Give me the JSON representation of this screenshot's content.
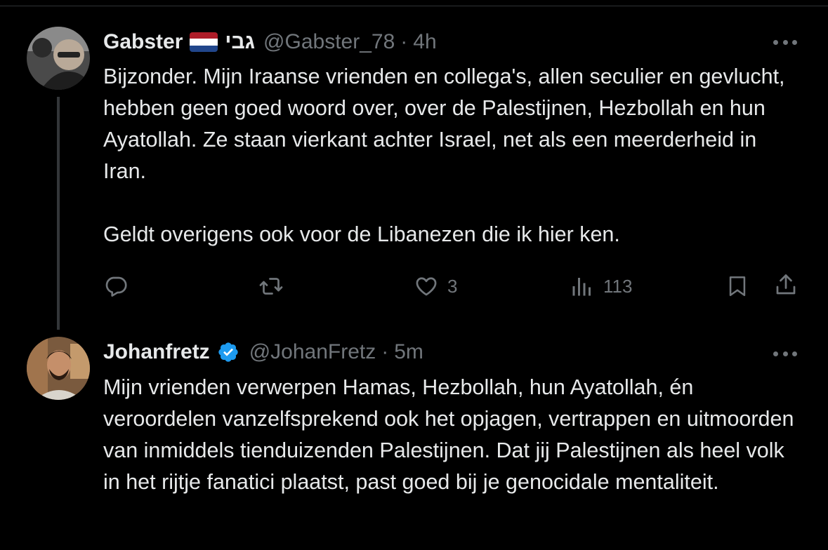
{
  "tweets": [
    {
      "name": "Gabster",
      "hebrew": "גבי",
      "handle": "@Gabster_78",
      "time": "4h",
      "paragraphs": [
        "Bijzonder. Mijn Iraanse vrienden en collega's, allen seculier en gevlucht, hebben geen goed woord over, over de Palestijnen, Hezbollah en hun Ayatollah. Ze staan vierkant achter Israel, net als een meerderheid in Iran.",
        "Geldt overigens ook voor de Libanezen die ik hier ken."
      ],
      "likes": "3",
      "views": "113"
    },
    {
      "name": "Johanfretz",
      "handle": "@JohanFretz",
      "time": "5m",
      "paragraphs": [
        "Mijn vrienden verwerpen Hamas, Hezbollah, hun Ayatollah, én veroordelen vanzelfsprekend ook het opjagen, vertrappen en uitmoorden van inmiddels tienduizenden Palestijnen. Dat jij Palestijnen als heel volk in het rijtje fanatici plaatst, past goed bij je genocidale mentaliteit."
      ]
    }
  ],
  "colors": {
    "background": "#000000",
    "text": "#e7e9ea",
    "muted": "#71767b",
    "verified": "#1d9bf0"
  },
  "icons": [
    "reply-icon",
    "retweet-icon",
    "like-icon",
    "views-icon",
    "bookmark-icon",
    "share-icon",
    "more-icon",
    "verified-badge-icon",
    "netherlands-flag-icon"
  ]
}
